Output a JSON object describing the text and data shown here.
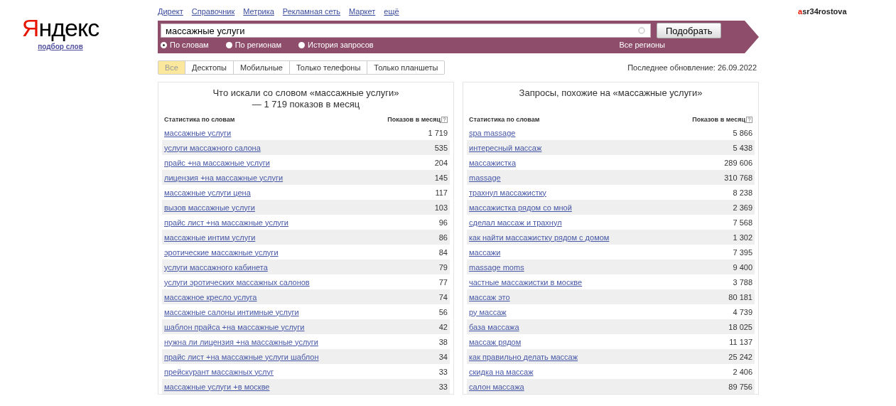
{
  "logo": {
    "text": "Яндекс",
    "subtitle": "подбор слов"
  },
  "top_links": [
    "Директ",
    "Справочник",
    "Метрика",
    "Рекламная сеть",
    "Маркет",
    "ещё"
  ],
  "user": "asr34rostova",
  "search": {
    "value": "массажные услуги",
    "button": "Подобрать",
    "region_link": "Все регионы"
  },
  "modes": [
    {
      "label": "По словам",
      "selected": true
    },
    {
      "label": "По регионам",
      "selected": false
    },
    {
      "label": "История запросов",
      "selected": false
    }
  ],
  "tabs": [
    {
      "label": "Все",
      "selected": true
    },
    {
      "label": "Десктопы",
      "selected": false
    },
    {
      "label": "Мобильные",
      "selected": false
    },
    {
      "label": "Только телефоны",
      "selected": false
    },
    {
      "label": "Только планшеты",
      "selected": false
    }
  ],
  "last_update": "Последнее обновление: 26.09.2022",
  "panels": [
    {
      "title": "Что искали со словом «массажные услуги» — 1 719 показов в месяц",
      "columns": [
        "Статистика по словам",
        "Показов в месяц"
      ],
      "rows": [
        {
          "phrase": "массажные услуги",
          "count": "1 719"
        },
        {
          "phrase": "услуги массажного салона",
          "count": "535"
        },
        {
          "phrase": "прайс +на массажные услуги",
          "count": "204"
        },
        {
          "phrase": "лицензия +на массажные услуги",
          "count": "145"
        },
        {
          "phrase": "массажные услуги цена",
          "count": "117"
        },
        {
          "phrase": "вызов массажные услуги",
          "count": "103"
        },
        {
          "phrase": "прайс лист +на массажные услуги",
          "count": "96"
        },
        {
          "phrase": "массажные интим услуги",
          "count": "86"
        },
        {
          "phrase": "эротические массажные услуги",
          "count": "84"
        },
        {
          "phrase": "услуги массажного кабинета",
          "count": "79"
        },
        {
          "phrase": "услуги эротических массажных салонов",
          "count": "77"
        },
        {
          "phrase": "массажное кресло услуга",
          "count": "74"
        },
        {
          "phrase": "массажные салоны интимные услуги",
          "count": "56"
        },
        {
          "phrase": "шаблон прайса +на массажные услуги",
          "count": "42"
        },
        {
          "phrase": "нужна ли лицензия +на массажные услуги",
          "count": "38"
        },
        {
          "phrase": "прайс лист +на массажные услуги шаблон",
          "count": "34"
        },
        {
          "phrase": "прейскурант массажных услуг",
          "count": "33"
        },
        {
          "phrase": "массажные услуги +в москве",
          "count": "33"
        }
      ]
    },
    {
      "title": "Запросы, похожие на «массажные услуги»",
      "columns": [
        "Статистика по словам",
        "Показов в месяц"
      ],
      "rows": [
        {
          "phrase": "spa massage",
          "count": "5 866"
        },
        {
          "phrase": "интересный массаж",
          "count": "5 438"
        },
        {
          "phrase": "массажистка",
          "count": "289 606"
        },
        {
          "phrase": "massage",
          "count": "310 768"
        },
        {
          "phrase": "трахнул массажистку",
          "count": "8 238"
        },
        {
          "phrase": "массажистка рядом со мной",
          "count": "2 369"
        },
        {
          "phrase": "сделал массаж и трахнул",
          "count": "7 568"
        },
        {
          "phrase": "как найти массажистку рядом с домом",
          "count": "1 302"
        },
        {
          "phrase": "массажи",
          "count": "7 395"
        },
        {
          "phrase": "massage moms",
          "count": "9 400"
        },
        {
          "phrase": "частные массажистки в москве",
          "count": "3 788"
        },
        {
          "phrase": "массаж это",
          "count": "80 181"
        },
        {
          "phrase": "ру массаж",
          "count": "4 739"
        },
        {
          "phrase": "база массажа",
          "count": "18 025"
        },
        {
          "phrase": "массаж рядом",
          "count": "11 137"
        },
        {
          "phrase": "как правильно делать массаж",
          "count": "25 242"
        },
        {
          "phrase": "скидка на массаж",
          "count": "2 406"
        },
        {
          "phrase": "салон массажа",
          "count": "89 756"
        }
      ]
    }
  ]
}
